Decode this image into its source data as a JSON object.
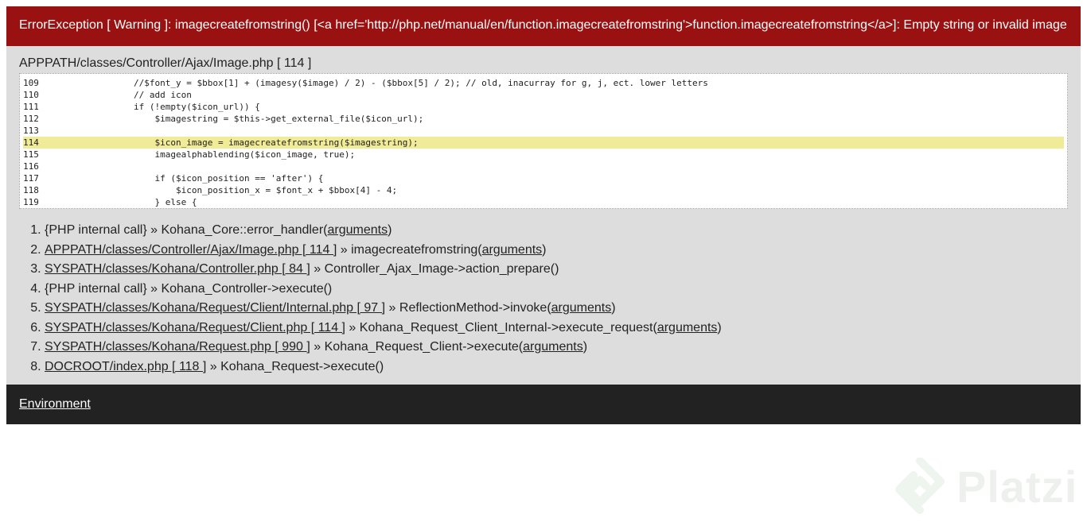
{
  "error": {
    "header": "ErrorException [ Warning ]: imagecreatefromstring() [<a href='http://php.net/manual/en/function.imagecreatefromstring'>function.imagecreatefromstring</a>]: Empty string or invalid image",
    "file_location": "APPPATH/classes/Controller/Ajax/Image.php [ 114 ]"
  },
  "source": [
    {
      "num": "109",
      "code": "        //$font_y = $bbox[1] + (imagesy($image) / 2) - ($bbox[5] / 2); // old, inacurray for g, j, ect. lower letters",
      "highlight": false
    },
    {
      "num": "110",
      "code": "        // add icon",
      "highlight": false
    },
    {
      "num": "111",
      "code": "        if (!empty($icon_url)) {",
      "highlight": false
    },
    {
      "num": "112",
      "code": "            $imagestring = $this->get_external_file($icon_url);",
      "highlight": false
    },
    {
      "num": "113",
      "code": "",
      "highlight": false
    },
    {
      "num": "114",
      "code": "            $icon_image = imagecreatefromstring($imagestring);",
      "highlight": true
    },
    {
      "num": "115",
      "code": "            imagealphablending($icon_image, true);",
      "highlight": false
    },
    {
      "num": "116",
      "code": "",
      "highlight": false
    },
    {
      "num": "117",
      "code": "            if ($icon_position == 'after') {",
      "highlight": false
    },
    {
      "num": "118",
      "code": "                $icon_position_x = $font_x + $bbox[4] - 4;",
      "highlight": false
    },
    {
      "num": "119",
      "code": "            } else {",
      "highlight": false
    }
  ],
  "trace": [
    {
      "num": "1.",
      "link": "",
      "text": "{PHP internal call} » Kohana_Core::error_handler(",
      "args": "arguments",
      "after": ")"
    },
    {
      "num": "2.",
      "link": "APPPATH/classes/Controller/Ajax/Image.php [ 114 ]",
      "text": " » imagecreatefromstring(",
      "args": "arguments",
      "after": ")"
    },
    {
      "num": "3.",
      "link": "SYSPATH/classes/Kohana/Controller.php [ 84 ]",
      "text": " » Controller_Ajax_Image->action_prepare()",
      "args": "",
      "after": ""
    },
    {
      "num": "4.",
      "link": "",
      "text": "{PHP internal call} » Kohana_Controller->execute()",
      "args": "",
      "after": ""
    },
    {
      "num": "5.",
      "link": "SYSPATH/classes/Kohana/Request/Client/Internal.php [ 97 ]",
      "text": " » ReflectionMethod->invoke(",
      "args": "arguments",
      "after": ")"
    },
    {
      "num": "6.",
      "link": "SYSPATH/classes/Kohana/Request/Client.php [ 114 ]",
      "text": " » Kohana_Request_Client_Internal->execute_request(",
      "args": "arguments",
      "after": ")"
    },
    {
      "num": "7.",
      "link": "SYSPATH/classes/Kohana/Request.php [ 990 ]",
      "text": " » Kohana_Request_Client->execute(",
      "args": "arguments",
      "after": ")"
    },
    {
      "num": "8.",
      "link": "DOCROOT/index.php [ 118 ]",
      "text": " » Kohana_Request->execute()",
      "args": "",
      "after": ""
    }
  ],
  "environment": {
    "label": "Environment"
  },
  "watermark": {
    "text": "Platzi",
    "icon": "platzi-logo-icon"
  },
  "colors": {
    "header_bg": "#991111",
    "content_bg": "#dddddd",
    "highlight": "#f0eb96",
    "env_bg": "#222222"
  }
}
